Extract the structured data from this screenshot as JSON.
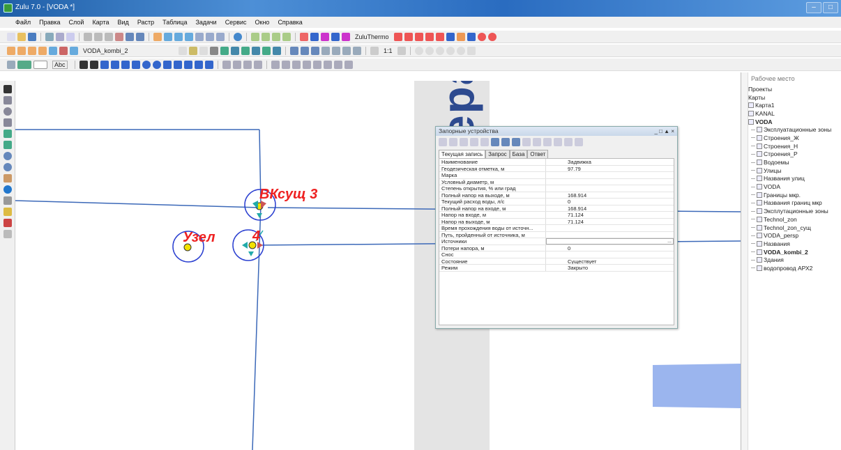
{
  "window": {
    "title": "Zulu 7.0 - [VODA *]",
    "controls": [
      "–",
      "□"
    ]
  },
  "menu": [
    "Файл",
    "Правка",
    "Слой",
    "Карта",
    "Вид",
    "Растр",
    "Таблица",
    "Задачи",
    "Сервис",
    "Окно",
    "Справка"
  ],
  "toolbar": {
    "layer_name": "VODA_kombi_2",
    "zulu_thermo": "ZuluThermo",
    "scale": "1:1",
    "text_tool": "Abc"
  },
  "map": {
    "big_label": "ера",
    "labels": {
      "vk": "ВКсущ 3",
      "uzel": "Узел",
      "four": "4"
    }
  },
  "workspace": {
    "title": "Рабочее место",
    "items": [
      {
        "label": "Проекты",
        "bold": false,
        "indent": 0
      },
      {
        "label": "Карты",
        "bold": false,
        "indent": 0
      },
      {
        "label": "Карта1",
        "bold": false,
        "indent": 0
      },
      {
        "label": "KANAL",
        "bold": false,
        "indent": 0
      },
      {
        "label": "VODA",
        "bold": true,
        "indent": 0
      },
      {
        "label": "Эксплуатационные зоны",
        "bold": false,
        "indent": 1
      },
      {
        "label": "Строения_Ж",
        "bold": false,
        "indent": 1
      },
      {
        "label": "Строения_Н",
        "bold": false,
        "indent": 1
      },
      {
        "label": "Строения_Р",
        "bold": false,
        "indent": 1
      },
      {
        "label": "Водоемы",
        "bold": false,
        "indent": 1
      },
      {
        "label": "Улицы",
        "bold": false,
        "indent": 1
      },
      {
        "label": "Названия улиц",
        "bold": false,
        "indent": 1
      },
      {
        "label": "VODA",
        "bold": false,
        "indent": 1
      },
      {
        "label": "Границы мкр.",
        "bold": false,
        "indent": 1
      },
      {
        "label": "Названия границ мкр",
        "bold": false,
        "indent": 1
      },
      {
        "label": "Эксплутационные зоны",
        "bold": false,
        "indent": 1
      },
      {
        "label": "Technol_zon",
        "bold": false,
        "indent": 1
      },
      {
        "label": "Technol_zon_сущ",
        "bold": false,
        "indent": 1
      },
      {
        "label": "VODA_persp",
        "bold": false,
        "indent": 1
      },
      {
        "label": "Названия",
        "bold": false,
        "indent": 1
      },
      {
        "label": "VODA_kombi_2",
        "bold": true,
        "indent": 1
      },
      {
        "label": "Здания",
        "bold": false,
        "indent": 1
      },
      {
        "label": "водопровод АРХ2",
        "bold": false,
        "indent": 1
      }
    ]
  },
  "dialog": {
    "title": "Запорные устройства",
    "title_controls": "_ □ ▲ ×",
    "tabs": [
      "Текущая запись",
      "Запрос",
      "База",
      "Ответ"
    ],
    "rows": [
      {
        "name": "Наименование",
        "value": "Задвижка"
      },
      {
        "name": "Геодезическая отметка, м",
        "value": "97.79"
      },
      {
        "name": "Марка",
        "value": ""
      },
      {
        "name": "Условный диаметр, м",
        "value": ""
      },
      {
        "name": "Степень открытия, % или град",
        "value": ""
      },
      {
        "name": "Полный напор на выходе, м",
        "value": "168.914"
      },
      {
        "name": "Текущий расход воды, л/с",
        "value": "0"
      },
      {
        "name": "Полный напор на входе, м",
        "value": "168.914"
      },
      {
        "name": "Напор на входе, м",
        "value": "71.124"
      },
      {
        "name": "Напор на выходе, м",
        "value": "71.124"
      },
      {
        "name": "Время прохождения воды от источн...",
        "value": ""
      },
      {
        "name": "Путь, пройденный от источника, м",
        "value": ""
      },
      {
        "name": "Источники",
        "value": "",
        "boxed": true,
        "ellipsis": "..."
      },
      {
        "name": "Потери напора, м",
        "value": "0"
      },
      {
        "name": "Снос",
        "value": ""
      },
      {
        "name": "Состояние",
        "value": "Существует"
      },
      {
        "name": "Режим",
        "value": "Закрыто"
      }
    ]
  },
  "colors": {
    "line": "#3b68b8",
    "label": "#e02020",
    "node": "#f2e200",
    "poly": "#9bb5ee"
  }
}
